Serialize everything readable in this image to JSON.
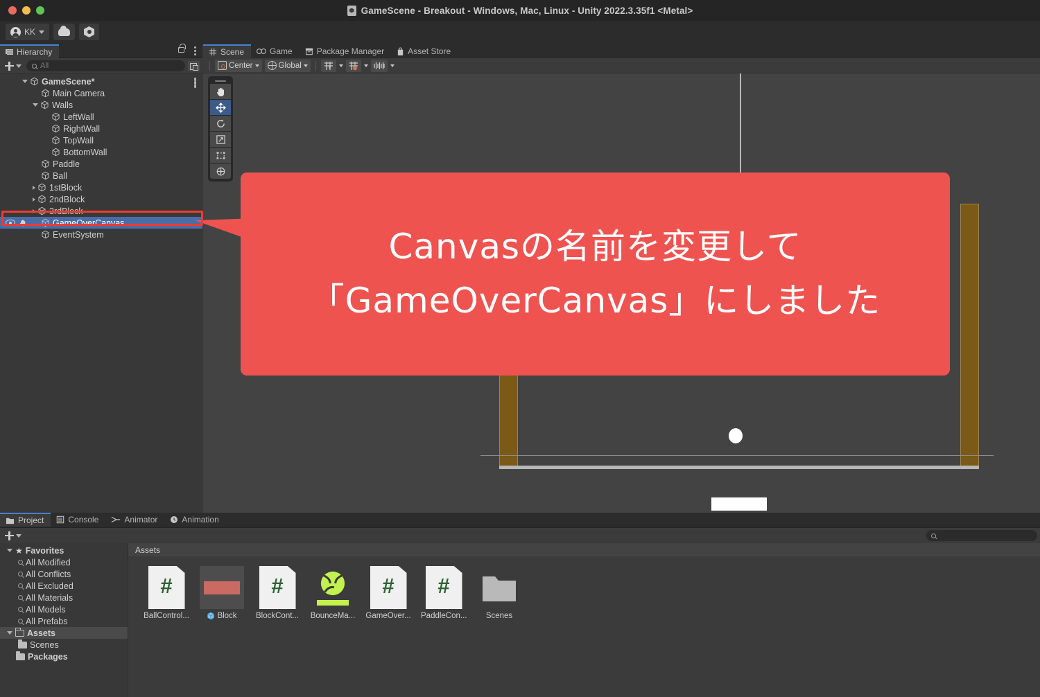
{
  "window": {
    "title": "GameScene - Breakout - Windows, Mac, Linux - Unity 2022.3.35f1 <Metal>",
    "doc_icon": "unity-scene-icon"
  },
  "toolbar": {
    "account_label": "KK",
    "account_icon": "account-avatar-icon",
    "cloud_icon": "cloud-icon",
    "settings_icon": "unity-services-gear-icon",
    "play_icon": "play-icon",
    "pause_icon": "pause-icon",
    "step_icon": "step-icon"
  },
  "hierarchy": {
    "tab_label": "Hierarchy",
    "tab_icon": "hierarchy-icon",
    "lock_icon": "lock-icon",
    "menu_icon": "kebab-menu-icon",
    "add_label": "+",
    "search_placeholder": "All",
    "search_value": "",
    "search_icon": "search-icon",
    "visibility_icon": "eye-icon",
    "pickability_icon": "hand-icon",
    "items": [
      {
        "label": "GameScene*",
        "depth": 0,
        "arrow": "open",
        "selected": false,
        "root": true
      },
      {
        "label": "Main Camera",
        "depth": 1,
        "arrow": "none",
        "selected": false
      },
      {
        "label": "Walls",
        "depth": 1,
        "arrow": "open",
        "selected": false
      },
      {
        "label": "LeftWall",
        "depth": 2,
        "arrow": "none",
        "selected": false
      },
      {
        "label": "RightWall",
        "depth": 2,
        "arrow": "none",
        "selected": false
      },
      {
        "label": "TopWall",
        "depth": 2,
        "arrow": "none",
        "selected": false
      },
      {
        "label": "BottomWall",
        "depth": 2,
        "arrow": "none",
        "selected": false
      },
      {
        "label": "Paddle",
        "depth": 1,
        "arrow": "none",
        "selected": false
      },
      {
        "label": "Ball",
        "depth": 1,
        "arrow": "none",
        "selected": false
      },
      {
        "label": "1stBlock",
        "depth": 1,
        "arrow": "closed",
        "selected": false
      },
      {
        "label": "2ndBlock",
        "depth": 1,
        "arrow": "closed",
        "selected": false
      },
      {
        "label": "3rdBlock",
        "depth": 1,
        "arrow": "closed",
        "selected": false
      },
      {
        "label": "GameOverCanvas",
        "depth": 1,
        "arrow": "none",
        "selected": true
      },
      {
        "label": "EventSystem",
        "depth": 1,
        "arrow": "none",
        "selected": false
      }
    ]
  },
  "scene_panel": {
    "tabs": [
      {
        "label": "Scene",
        "icon": "scene-grid-icon",
        "active": true
      },
      {
        "label": "Game",
        "icon": "gamepad-icon",
        "active": false
      },
      {
        "label": "Package Manager",
        "icon": "package-icon",
        "active": false
      },
      {
        "label": "Asset Store",
        "icon": "store-bag-icon",
        "active": false
      }
    ],
    "toolbar": {
      "pivot_label": "Center",
      "pivot_icon": "pivot-center-icon",
      "handle_label": "Global",
      "handle_icon": "globe-icon",
      "grid_icon": "grid-axis-icon",
      "snap_icon": "snap-increment-icon",
      "ruler_icon": "grid-visibility-icon"
    },
    "tools": [
      {
        "name": "hand-tool",
        "icon": "hand-icon",
        "active": false
      },
      {
        "name": "move-tool",
        "icon": "move-arrows-icon",
        "active": true
      },
      {
        "name": "rotate-tool",
        "icon": "rotate-icon",
        "active": false
      },
      {
        "name": "scale-tool",
        "icon": "scale-icon",
        "active": false
      },
      {
        "name": "rect-tool",
        "icon": "rect-transform-icon",
        "active": false
      },
      {
        "name": "transform-tool",
        "icon": "transform-icon",
        "active": false
      }
    ],
    "colors": {
      "background": "#434343",
      "wall": "#7a5a16",
      "ball": "#ffffff",
      "paddle": "#ffffff",
      "guide_line": "#b7b7b7"
    }
  },
  "callout": {
    "line1": "Canvasの名前を変更して",
    "line2": "「GameOverCanvas」にしました",
    "color": "#ef5350",
    "highlight_color": "#ef3b30"
  },
  "project_panel": {
    "tabs": [
      {
        "label": "Project",
        "icon": "folder-icon",
        "active": true
      },
      {
        "label": "Console",
        "icon": "console-icon",
        "active": false
      },
      {
        "label": "Animator",
        "icon": "animator-icon",
        "active": false
      },
      {
        "label": "Animation",
        "icon": "clock-icon",
        "active": false
      }
    ],
    "add_label": "+",
    "search_placeholder": "",
    "search_value": "",
    "search_icon": "search-icon",
    "sidebar": [
      {
        "label": "Favorites",
        "type": "root",
        "arrow": "open",
        "icon": "star-icon",
        "depth": 0
      },
      {
        "label": "All Modified",
        "type": "saved-search",
        "icon": "search-icon",
        "depth": 1
      },
      {
        "label": "All Conflicts",
        "type": "saved-search",
        "icon": "search-icon",
        "depth": 1
      },
      {
        "label": "All Excluded",
        "type": "saved-search",
        "icon": "search-icon",
        "depth": 1
      },
      {
        "label": "All Materials",
        "type": "saved-search",
        "icon": "search-icon",
        "depth": 1
      },
      {
        "label": "All Models",
        "type": "saved-search",
        "icon": "search-icon",
        "depth": 1
      },
      {
        "label": "All Prefabs",
        "type": "saved-search",
        "icon": "search-icon",
        "depth": 1
      },
      {
        "label": "Assets",
        "type": "folder",
        "arrow": "open",
        "icon": "folder-open-icon",
        "depth": 0,
        "highlighted": true
      },
      {
        "label": "Scenes",
        "type": "folder",
        "icon": "folder-icon",
        "depth": 1
      },
      {
        "label": "Packages",
        "type": "folder",
        "icon": "folder-icon",
        "depth": 0
      }
    ],
    "breadcrumb": "Assets",
    "assets": [
      {
        "label": "BallControl...",
        "kind": "csharp-script"
      },
      {
        "label": "Block",
        "kind": "prefab"
      },
      {
        "label": "BlockCont...",
        "kind": "csharp-script"
      },
      {
        "label": "BounceMa...",
        "kind": "physics-material"
      },
      {
        "label": "GameOver...",
        "kind": "csharp-script"
      },
      {
        "label": "PaddleCon...",
        "kind": "csharp-script"
      },
      {
        "label": "Scenes",
        "kind": "folder"
      }
    ]
  }
}
